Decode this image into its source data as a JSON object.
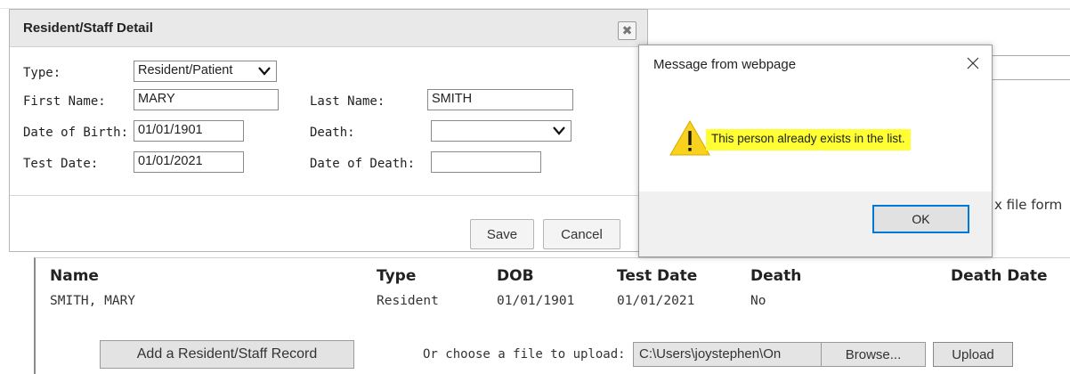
{
  "background": {
    "partial_text": "x file form"
  },
  "table": {
    "headers": [
      "Name",
      "Type",
      "DOB",
      "Test Date",
      "Death",
      "Death Date"
    ],
    "rows": [
      {
        "name": "SMITH, MARY",
        "type": "Resident",
        "dob": "01/01/1901",
        "test_date": "01/01/2021",
        "death": "No",
        "death_date": ""
      }
    ]
  },
  "footer": {
    "add_button_label": "Add a Resident/Staff Record",
    "choose_file_label": "Or choose a file to upload:",
    "file_path_value": "C:\\Users\\joystephen\\On",
    "browse_label": "Browse...",
    "upload_label": "Upload"
  },
  "dialog": {
    "title": "Resident/Staff Detail",
    "close_glyph": "✖",
    "fields": {
      "type_label": "Type:",
      "type_value": "Resident/Patient",
      "first_name_label": "First Name:",
      "first_name_value": "MARY",
      "last_name_label": "Last Name:",
      "last_name_value": "SMITH",
      "dob_label": "Date of Birth:",
      "dob_value": "01/01/1901",
      "death_label": "Death:",
      "death_value": "",
      "test_date_label": "Test Date:",
      "test_date_value": "01/01/2021",
      "date_of_death_label": "Date of Death:",
      "date_of_death_value": ""
    },
    "save_label": "Save",
    "cancel_label": "Cancel"
  },
  "alert": {
    "title": "Message from webpage",
    "message": "This person already exists in the list.",
    "ok_label": "OK",
    "icon": "warning-triangle-icon",
    "highlight_color": "#ffff33",
    "ok_border_color": "#0078d7"
  }
}
